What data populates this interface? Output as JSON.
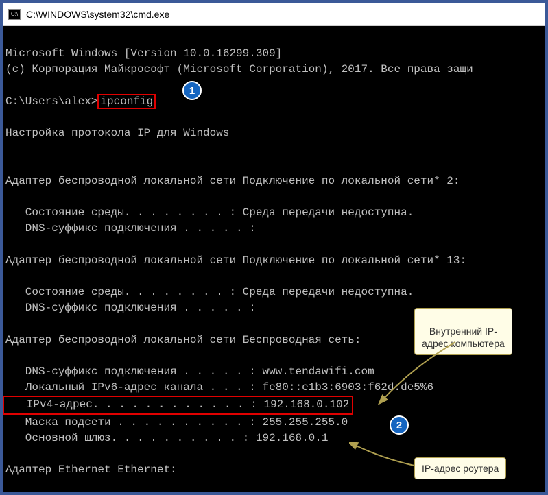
{
  "window": {
    "title": "C:\\WINDOWS\\system32\\cmd.exe"
  },
  "terminal": {
    "line_version": "Microsoft Windows [Version 10.0.16299.309]",
    "line_copyright": "(c) Корпорация Майкрософт (Microsoft Corporation), 2017. Все права защи",
    "prompt": "C:\\Users\\alex>",
    "command": "ipconfig",
    "heading": "Настройка протокола IP для Windows",
    "adapter1_title": "Адаптер беспроводной локальной сети Подключение по локальной сети* 2:",
    "adapter1_media": "   Состояние среды. . . . . . . . : Среда передачи недоступна.",
    "adapter1_dns": "   DNS-суффикс подключения . . . . . :",
    "adapter2_title": "Адаптер беспроводной локальной сети Подключение по локальной сети* 13:",
    "adapter2_media": "   Состояние среды. . . . . . . . : Среда передачи недоступна.",
    "adapter2_dns": "   DNS-суффикс подключения . . . . . :",
    "adapter3_title": "Адаптер беспроводной локальной сети Беспроводная сеть:",
    "adapter3_dns": "   DNS-суффикс подключения . . . . . : www.tendawifi.com",
    "adapter3_ipv6": "   Локальный IPv6-адрес канала . . . : fe80::e1b3:6903:f62d:de5%6",
    "adapter3_ipv4": "   IPv4-адрес. . . . . . . . . . . . : 192.168.0.102",
    "adapter3_mask": "   Маска подсети . . . . . . . . . . : 255.255.255.0",
    "adapter3_gw": "   Основной шлюз. . . . . . . . . . : 192.168.0.1",
    "adapter4_title": "Адаптер Ethernet Ethernet:"
  },
  "callouts": {
    "num1": "1",
    "num2": "2"
  },
  "annotations": {
    "internal_ip": "Внутренний IP-\nадрес компьютера",
    "router_ip": "IP-адрес роутера"
  }
}
